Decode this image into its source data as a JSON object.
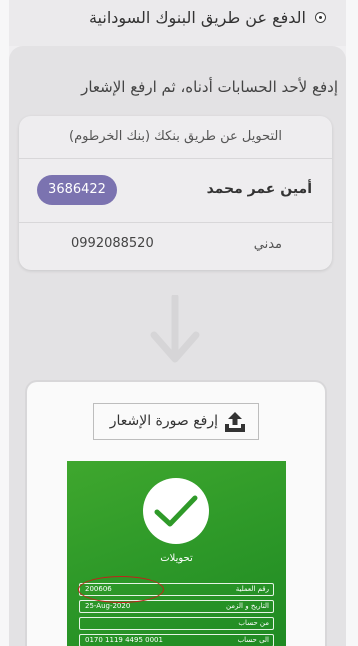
{
  "payment_option": {
    "label": "الدفع عن طريق البنوك السودانية",
    "selected": true
  },
  "instruction": "إدفع لأحد الحسابات أدناه، ثم ارفع الإشعار",
  "account_card": {
    "header": "التحويل عن طريق بنكك (بنك الخرطوم)",
    "account_name": "أمين عمر محمد",
    "account_number": "3686422",
    "account_type": "مدني",
    "phone": "0992088520"
  },
  "upload": {
    "button_label": "إرفع صورة الإشعار",
    "icon": "upload-icon"
  },
  "sample_receipt": {
    "title": "تحويلات",
    "rows": [
      {
        "label": "رقم العملية",
        "value": "200606"
      },
      {
        "label": "التاريخ و الزمن",
        "value": "25-Aug-2020"
      },
      {
        "label": "من حساب",
        "value": ""
      },
      {
        "label": "الى حساب",
        "value": "0170 1119 4495 0001"
      }
    ]
  },
  "colors": {
    "badge": "#7b73b0",
    "receipt_green": "#2f9a29",
    "highlight": "#c0241a"
  }
}
